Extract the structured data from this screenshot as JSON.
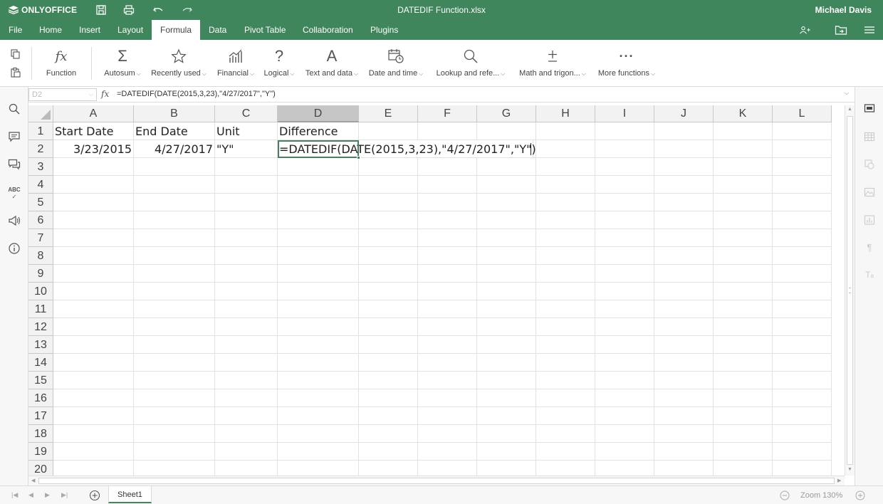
{
  "app": {
    "logo": "ONLYOFFICE",
    "doc_title": "DATEDIF Function.xlsx",
    "user": "Michael Davis"
  },
  "menu": {
    "tabs": [
      "File",
      "Home",
      "Insert",
      "Layout",
      "Formula",
      "Data",
      "Pivot Table",
      "Collaboration",
      "Plugins"
    ],
    "active": "Formula"
  },
  "ribbon": {
    "function": "Function",
    "autosum": "Autosum",
    "recently_used": "Recently used",
    "financial": "Financial",
    "logical": "Logical",
    "text_and_data": "Text and data",
    "date_and_time": "Date and time",
    "lookup": "Lookup and refe...",
    "math": "Math and trigon...",
    "more": "More functions"
  },
  "formula_bar": {
    "name_box": "D2",
    "fx": "fx",
    "formula": "=DATEDIF(DATE(2015,3,23),\"4/27/2017\",\"Y\")"
  },
  "grid": {
    "columns": [
      "A",
      "B",
      "C",
      "D",
      "E",
      "F",
      "G",
      "H",
      "I",
      "J",
      "K",
      "L"
    ],
    "rows": [
      "1",
      "2",
      "3",
      "4",
      "5",
      "6",
      "7",
      "8",
      "9",
      "10",
      "11",
      "12",
      "13",
      "14",
      "15",
      "16",
      "17",
      "18",
      "19",
      "20"
    ],
    "cells": {
      "A1": "Start Date",
      "B1": "End Date",
      "C1": "Unit",
      "D1": "Difference",
      "A2": "3/23/2015",
      "B2": "4/27/2017",
      "C2": "\"Y\"",
      "D2": "=DATEDIF(DATE(2015,3,23),\"4/27/2017\",\"Y\")"
    }
  },
  "status": {
    "sheet": "Sheet1",
    "zoom": "Zoom 130%"
  },
  "colors": {
    "brand": "#40865c"
  }
}
